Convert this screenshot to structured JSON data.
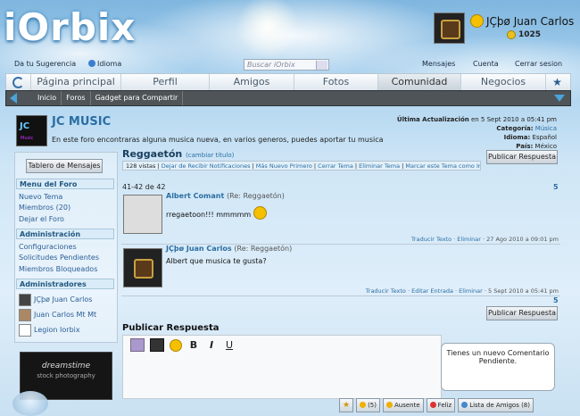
{
  "brand": {
    "logo": "iOrbix"
  },
  "user": {
    "name": "JÇþø Juan Carlos",
    "points": "1025"
  },
  "toplinks": {
    "suggest": "Da tu Sugerencia",
    "language": "Idioma",
    "messages": "Mensajes",
    "account": "Cuenta",
    "logout": "Cerrar sesion"
  },
  "search": {
    "placeholder": "Buscar iOrbix"
  },
  "nav": {
    "tabs": [
      "Página principal",
      "Perfil",
      "Amigos",
      "Fotos",
      "Comunidad",
      "Negocios"
    ],
    "active": "Comunidad"
  },
  "subnav": {
    "items": [
      "Inicio",
      "Foros",
      "Gadget para Compartir"
    ]
  },
  "forum": {
    "logo_text": "JC",
    "logo_sub": "Music",
    "title": "JC MUSIC",
    "description": "En este foro encontraras alguna musica nueva, en varios generos, puedes aportar tu musica",
    "last_update_label": "Última Actualización",
    "last_update_value": "en 5 Sept 2010 a 05:41 pm",
    "category_label": "Categoría:",
    "category_value": "Música",
    "language_label": "Idioma:",
    "language_value": "Español",
    "country_label": "País:",
    "country_value": "México",
    "publish_reply": "Publicar Respuesta"
  },
  "sidebar": {
    "board_button": "Tablero de Mensajes",
    "menu_header": "Menu del Foro",
    "menu": [
      "Nuevo Tema",
      "Miembros (20)",
      "Dejar el Foro"
    ],
    "admin_header": "Administración",
    "admin": [
      "Configuraciones",
      "Solicitudes Pendientes",
      "Miembros Bloqueados"
    ],
    "admins_header": "Administradores",
    "admins": [
      "JÇþø Juan Carlos",
      "Juan Carlos Mt Mt",
      "Legion Iorbix"
    ],
    "ad_title": "dreamstime",
    "ad_sub": "stock photography"
  },
  "thread": {
    "title": "Reggaetón",
    "change_title": "(cambiar título)",
    "views": "128 vistas",
    "actions": [
      "Dejar de Recibir Notificaciones",
      "Más Nuevo Primero",
      "Cerrar Tema",
      "Eliminar Tema",
      "Marcar este Tema como Importante"
    ],
    "count": "41-42 de 42",
    "page": "5",
    "posts": [
      {
        "author": "Albert Comant",
        "re": "(Re: Reggaetón)",
        "body": "rregaetoon!!! mmmmm",
        "footer_links": "Traducir Texto · Eliminar",
        "date": "· 27 Ago 2010 a 09:01 pm"
      },
      {
        "author": "JÇþø Juan Carlos",
        "re": "(Re: Reggaetón)",
        "body": "Albert que musica te gusta?",
        "footer_links": "Traducir Texto · Editar Entrada · Eliminar",
        "date": "· 5 Sept 2010 a 05:41 pm"
      }
    ]
  },
  "reply": {
    "title": "Publicar Respuesta",
    "bold": "B",
    "italic": "I",
    "underline": "U"
  },
  "notification": {
    "text": "Tienes un nuevo Comentario Pendiente."
  },
  "bottombar": {
    "count": "(5)",
    "status": "Ausente",
    "mood": "Feliz",
    "friends": "Lista de Amigos (8)"
  }
}
